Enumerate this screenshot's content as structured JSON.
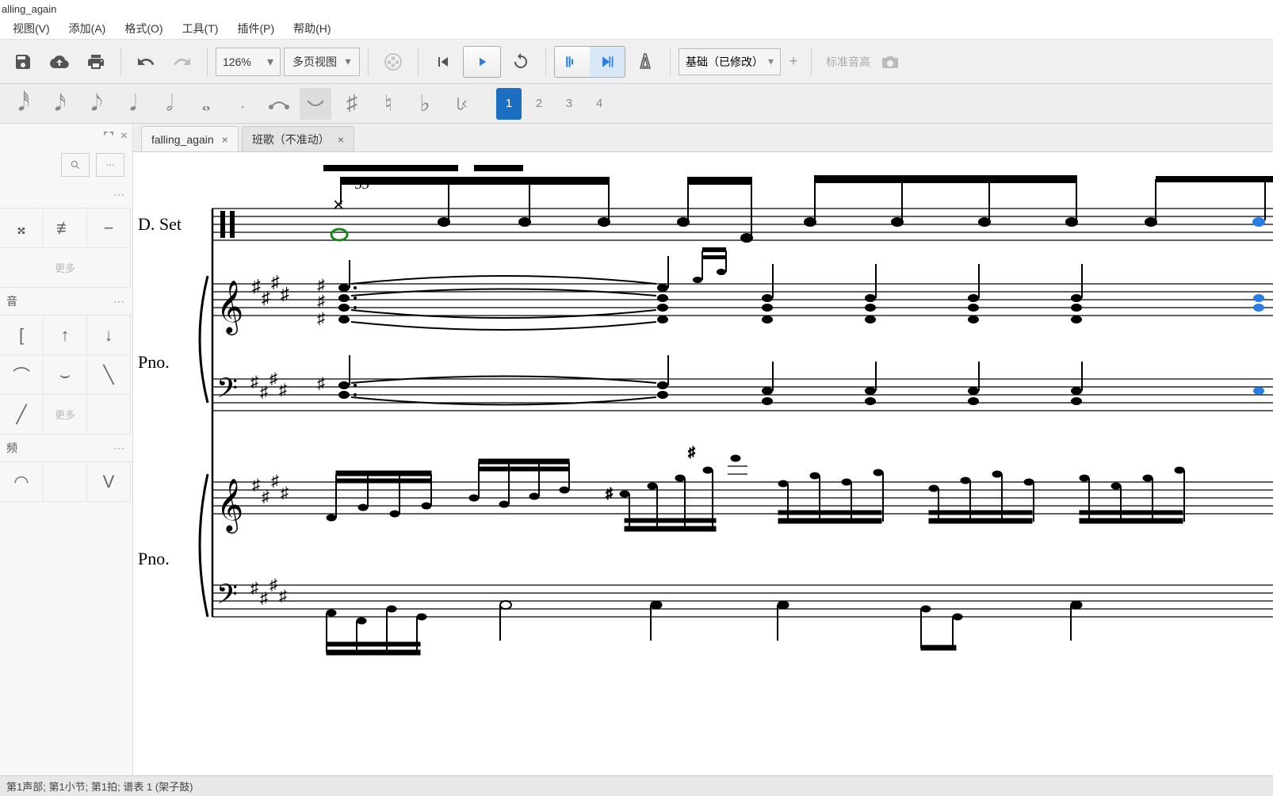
{
  "window_title": "alling_again",
  "menubar": {
    "view": "视图(V)",
    "add": "添加(A)",
    "format": "格式(O)",
    "tools": "工具(T)",
    "plugins": "插件(P)",
    "help": "帮助(H)"
  },
  "toolbar": {
    "zoom_value": "126%",
    "view_mode": "多页视图",
    "workspace": "基础（已修改）",
    "concert_pitch": "标准音高"
  },
  "voices": {
    "v1": "1",
    "v2": "2",
    "v3": "3",
    "v4": "4"
  },
  "sidebar": {
    "search_placeholder": "",
    "tremolo_more": "更多",
    "lines_more": "更多",
    "section_tremolo": "音",
    "section_lines": "频"
  },
  "tabs": {
    "t0": {
      "label": "falling_again"
    },
    "t1": {
      "label": "班歌（不准动）"
    }
  },
  "score": {
    "measure_number": "35",
    "instrument_drumset": "D. Set",
    "instrument_piano": "Pno.",
    "instrument_piano2": "Pno."
  },
  "statusbar_text": "第1声部;  第1小节; 第1拍; 谱表 1 (架子鼓)"
}
